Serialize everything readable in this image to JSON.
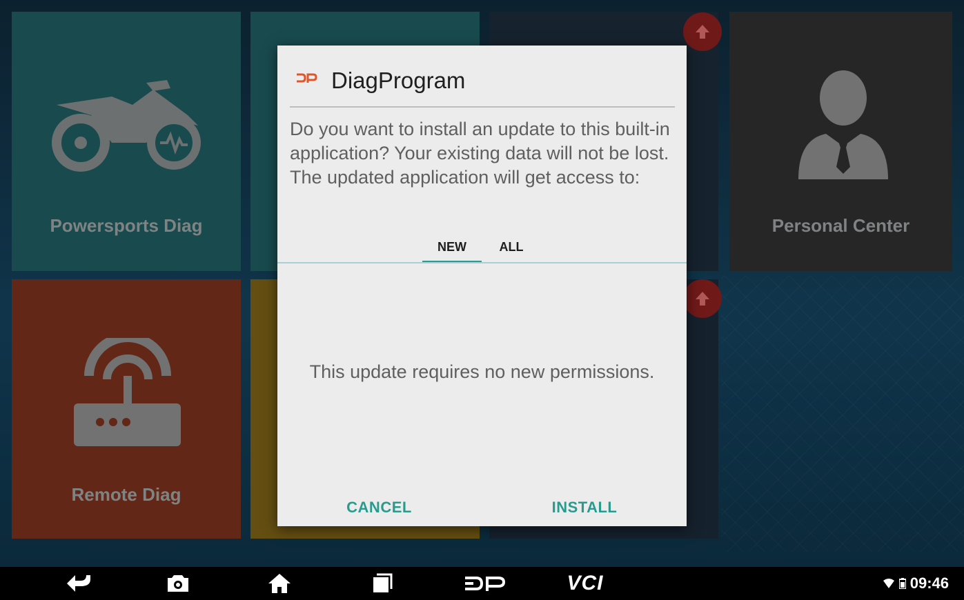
{
  "tiles": {
    "powersports": "Powersports Diag",
    "personal": "Personal Center",
    "remote": "Remote Diag"
  },
  "dialog": {
    "app_name": "DiagProgram",
    "message": "Do you want to install an update to this built-in application? Your existing data will not be lost. The updated application will get access to:",
    "tabs": [
      "NEW",
      "ALL"
    ],
    "selected_tab": "NEW",
    "body_text": "This update requires no new permissions.",
    "cancel_label": "CANCEL",
    "install_label": "INSTALL",
    "accent_color": "#2b9a8e"
  },
  "navbar": {
    "icons": [
      "back-icon",
      "camera-icon",
      "home-icon",
      "recents-icon",
      "dp-logo-icon",
      "vci-icon"
    ],
    "vci_label": "VCI",
    "time": "09:46"
  }
}
